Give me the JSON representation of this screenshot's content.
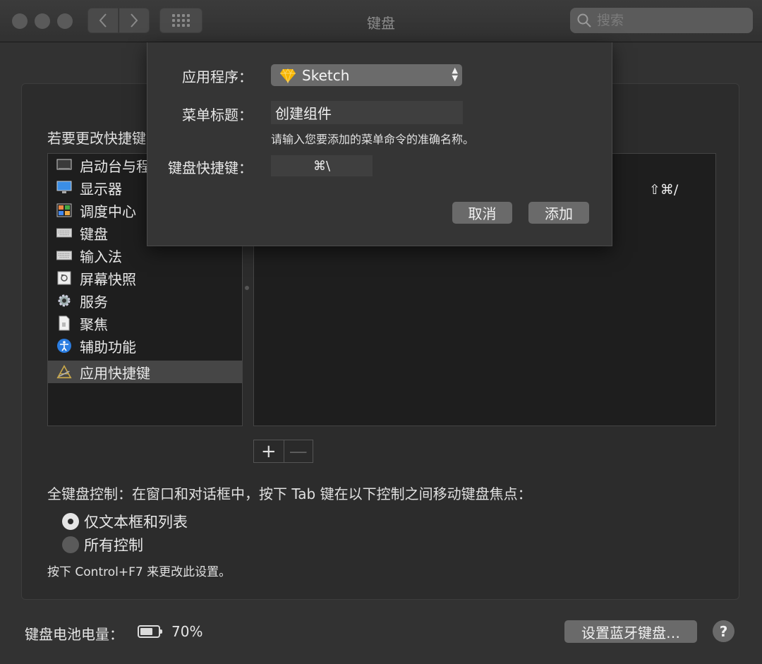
{
  "window": {
    "title": "键盘",
    "search_placeholder": "搜索"
  },
  "panel": {
    "instruction": "若要更改快捷键",
    "categories": [
      {
        "label": "启动台与程",
        "icon": "launchpad-icon"
      },
      {
        "label": "显示器",
        "icon": "display-icon"
      },
      {
        "label": "调度中心",
        "icon": "mission-control-icon"
      },
      {
        "label": "键盘",
        "icon": "keyboard-icon"
      },
      {
        "label": "输入法",
        "icon": "input-source-icon"
      },
      {
        "label": "屏幕快照",
        "icon": "screenshot-icon"
      },
      {
        "label": "服务",
        "icon": "gear-icon"
      },
      {
        "label": "聚焦",
        "icon": "spotlight-icon"
      },
      {
        "label": "辅助功能",
        "icon": "accessibility-icon"
      },
      {
        "label": "应用快捷键",
        "icon": "app-shortcuts-icon",
        "selected": true
      }
    ],
    "shortcut_value": "⇧⌘/",
    "add_symbol": "+",
    "remove_symbol": "—",
    "full_keyboard_label": "全键盘控制：在窗口和对话框中，按下 Tab 键在以下控制之间移动键盘焦点：",
    "radio_options": [
      {
        "label": "仅文本框和列表",
        "checked": true
      },
      {
        "label": "所有控制",
        "checked": false
      }
    ],
    "hint": "按下 Control+F7 来更改此设置。"
  },
  "footer": {
    "battery_label": "键盘电池电量：",
    "battery_percent_text": "70%",
    "battery_level": 0.7,
    "bluetooth_button": "设置蓝牙键盘…",
    "help_button": "?"
  },
  "sheet": {
    "app_label": "应用程序：",
    "app_value": "Sketch",
    "menu_title_label": "菜单标题：",
    "menu_title_value": "创建组件",
    "menu_title_hint": "请输入您要添加的菜单命令的准确名称。",
    "shortcut_label": "键盘快捷键：",
    "shortcut_value": "⌘\\",
    "cancel_button": "取消",
    "add_button": "添加"
  },
  "colors": {
    "window_bg": "#323232",
    "list_bg": "#1e1e1e",
    "button_bg": "#6a6a6a",
    "sketch_diamond": "#f7b500"
  }
}
